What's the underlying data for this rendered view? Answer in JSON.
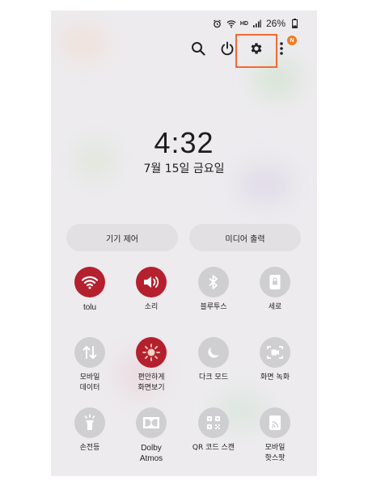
{
  "status_bar": {
    "hd_label": "HD",
    "battery_text": "26%"
  },
  "top_actions": {
    "search_icon": "search-icon",
    "power_icon": "power-icon",
    "settings_icon": "gear-icon",
    "more_icon": "more-vertical-icon",
    "notification_badge": "N",
    "highlight_color": "#f06a35"
  },
  "clock": {
    "time": "4:32",
    "date": "7월 15일 금요일"
  },
  "buttons": {
    "device_control": "기기 제어",
    "media_output": "미디어 출력"
  },
  "accent_color": "#b5202e",
  "tiles": [
    {
      "label": "tolu",
      "icon": "wifi-icon",
      "active": true
    },
    {
      "label": "소리",
      "icon": "speaker-icon",
      "active": true
    },
    {
      "label": "블루투스",
      "icon": "bluetooth-icon",
      "active": false
    },
    {
      "label": "세로",
      "icon": "portrait-lock-icon",
      "active": false
    },
    {
      "label": "모바일\n데이터",
      "icon": "mobile-data-icon",
      "active": false
    },
    {
      "label": "편안하게\n화면보기",
      "icon": "eye-comfort-icon",
      "active": true
    },
    {
      "label": "다크 모드",
      "icon": "moon-icon",
      "active": false
    },
    {
      "label": "화면 녹화",
      "icon": "screen-record-icon",
      "active": false
    },
    {
      "label": "손전등",
      "icon": "flashlight-icon",
      "active": false
    },
    {
      "label": "Dolby\nAtmos",
      "icon": "dolby-icon",
      "active": false
    },
    {
      "label": "QR 코드 스캔",
      "icon": "qr-code-icon",
      "active": false
    },
    {
      "label": "모바일\n핫스팟",
      "icon": "hotspot-icon",
      "active": false
    }
  ]
}
